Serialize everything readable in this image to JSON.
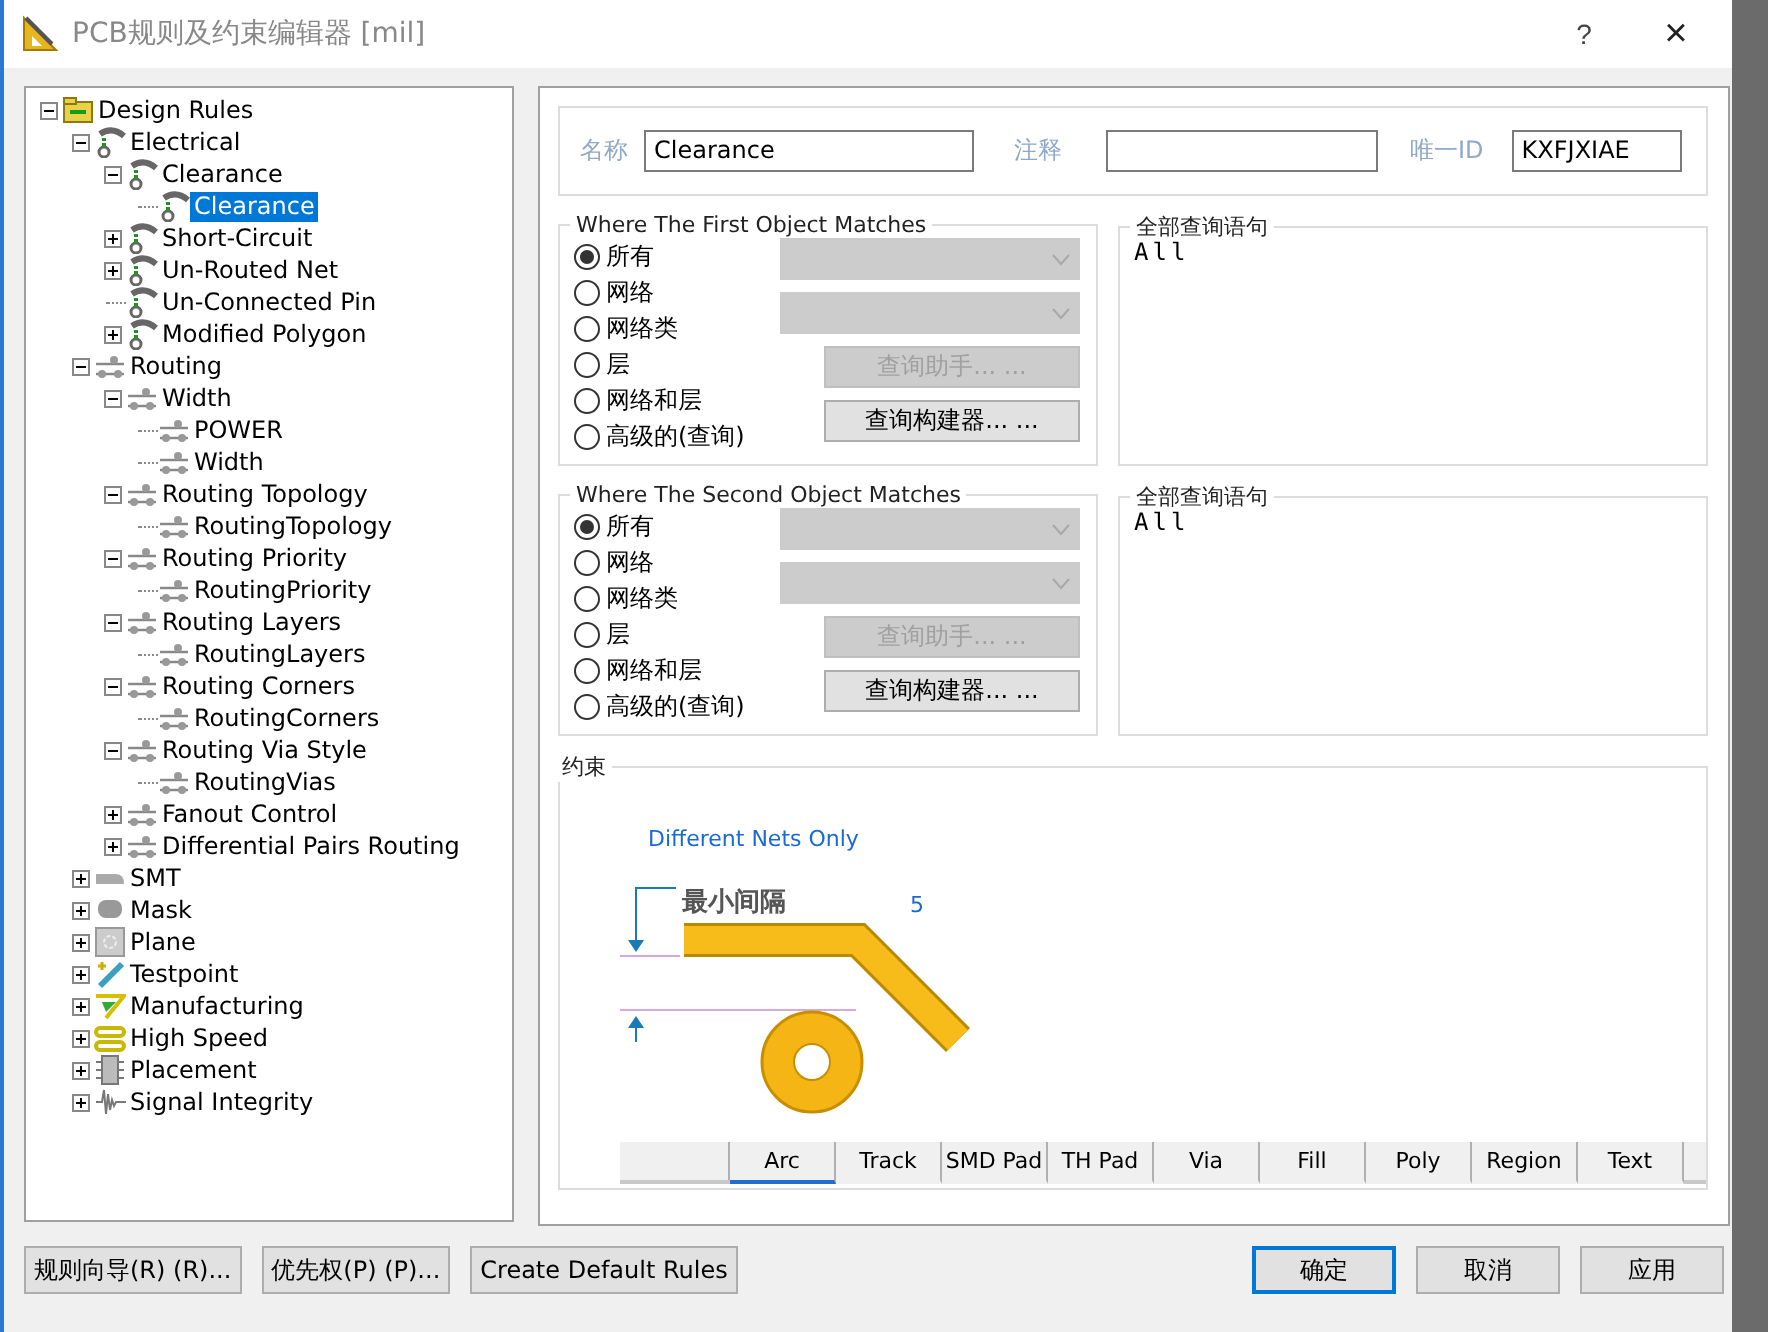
{
  "window": {
    "title": "PCB规则及约束编辑器 [mil]",
    "help": "?",
    "close": "×"
  },
  "tree": [
    {
      "label": "Design Rules",
      "kind": "folder",
      "expanded": true,
      "selected": false,
      "children": [
        {
          "label": "Electrical",
          "kind": "electrical",
          "expanded": true,
          "selected": false,
          "children": [
            {
              "label": "Clearance",
              "kind": "electrical",
              "expanded": true,
              "selected": false,
              "children": [
                {
                  "label": "Clearance",
                  "kind": "electrical",
                  "selected": true
                }
              ]
            },
            {
              "label": "Short-Circuit",
              "kind": "electrical",
              "expanded": false,
              "selected": false
            },
            {
              "label": "Un-Routed Net",
              "kind": "electrical",
              "expanded": false,
              "selected": false
            },
            {
              "label": "Un-Connected Pin",
              "kind": "electrical",
              "selected": false
            },
            {
              "label": "Modified Polygon",
              "kind": "electrical",
              "expanded": false,
              "selected": false
            }
          ]
        },
        {
          "label": "Routing",
          "kind": "routing",
          "expanded": true,
          "selected": false,
          "children": [
            {
              "label": "Width",
              "kind": "routing",
              "expanded": true,
              "selected": false,
              "children": [
                {
                  "label": "POWER",
                  "kind": "routing",
                  "selected": false
                },
                {
                  "label": "Width",
                  "kind": "routing",
                  "selected": false
                }
              ]
            },
            {
              "label": "Routing Topology",
              "kind": "routing",
              "expanded": true,
              "selected": false,
              "children": [
                {
                  "label": "RoutingTopology",
                  "kind": "routing",
                  "selected": false
                }
              ]
            },
            {
              "label": "Routing Priority",
              "kind": "routing",
              "expanded": true,
              "selected": false,
              "children": [
                {
                  "label": "RoutingPriority",
                  "kind": "routing",
                  "selected": false
                }
              ]
            },
            {
              "label": "Routing Layers",
              "kind": "routing",
              "expanded": true,
              "selected": false,
              "children": [
                {
                  "label": "RoutingLayers",
                  "kind": "routing",
                  "selected": false
                }
              ]
            },
            {
              "label": "Routing Corners",
              "kind": "routing",
              "expanded": true,
              "selected": false,
              "children": [
                {
                  "label": "RoutingCorners",
                  "kind": "routing",
                  "selected": false
                }
              ]
            },
            {
              "label": "Routing Via Style",
              "kind": "routing",
              "expanded": true,
              "selected": false,
              "children": [
                {
                  "label": "RoutingVias",
                  "kind": "routing",
                  "selected": false
                }
              ]
            },
            {
              "label": "Fanout Control",
              "kind": "routing",
              "expanded": false,
              "selected": false
            },
            {
              "label": "Differential Pairs Routing",
              "kind": "routing",
              "expanded": false,
              "selected": false
            }
          ]
        },
        {
          "label": "SMT",
          "kind": "smt",
          "expanded": false,
          "selected": false
        },
        {
          "label": "Mask",
          "kind": "mask",
          "expanded": false,
          "selected": false
        },
        {
          "label": "Plane",
          "kind": "plane",
          "expanded": false,
          "selected": false
        },
        {
          "label": "Testpoint",
          "kind": "testpoint",
          "expanded": false,
          "selected": false
        },
        {
          "label": "Manufacturing",
          "kind": "manufacturing",
          "expanded": false,
          "selected": false
        },
        {
          "label": "High Speed",
          "kind": "highspeed",
          "expanded": false,
          "selected": false
        },
        {
          "label": "Placement",
          "kind": "placement",
          "expanded": false,
          "selected": false
        },
        {
          "label": "Signal Integrity",
          "kind": "signal",
          "expanded": false,
          "selected": false
        }
      ]
    }
  ],
  "rule": {
    "name_label": "名称",
    "name": "Clearance",
    "comment_label": "注释",
    "id_label": "唯一ID",
    "id": "KXFJXIAE"
  },
  "matches": [
    {
      "title": "Where The First Object Matches",
      "options": [
        {
          "label": "所有",
          "selected": true
        },
        {
          "label": "网络",
          "selected": false
        },
        {
          "label": "网络类",
          "selected": false
        },
        {
          "label": "层",
          "selected": false
        },
        {
          "label": "网络和层",
          "selected": false
        },
        {
          "label": "高级的(查询)",
          "selected": false
        }
      ],
      "dropdowns": [
        {
          "disabled": true
        },
        {
          "disabled": true
        }
      ],
      "helper_button": {
        "label": "查询助手... ...",
        "disabled": true
      },
      "builder_button": {
        "label": "查询构建器... ...",
        "disabled": false
      },
      "query_title": "全部查询语句",
      "query": "All"
    },
    {
      "title": "Where The Second Object Matches",
      "options": [
        {
          "label": "所有",
          "selected": true
        },
        {
          "label": "网络",
          "selected": false
        },
        {
          "label": "网络类",
          "selected": false
        },
        {
          "label": "层",
          "selected": false
        },
        {
          "label": "网络和层",
          "selected": false
        },
        {
          "label": "高级的(查询)",
          "selected": false
        }
      ],
      "dropdowns": [
        {
          "disabled": true
        },
        {
          "disabled": true
        }
      ],
      "helper_button": {
        "label": "查询助手... ...",
        "disabled": true
      },
      "builder_button": {
        "label": "查询构建器... ...",
        "disabled": false
      },
      "query_title": "全部查询语句",
      "query": "All"
    }
  ],
  "constraint": {
    "title": "约束",
    "net_scope": "Different Nets Only",
    "gap_label": "最小间隔",
    "gap_value": "5",
    "object_tabs": [
      {
        "label": "Arc",
        "selected": true
      },
      {
        "label": "Track",
        "selected": false
      },
      {
        "label": "SMD Pad",
        "selected": false
      },
      {
        "label": "TH Pad",
        "selected": false
      },
      {
        "label": "Via",
        "selected": false
      },
      {
        "label": "Fill",
        "selected": false
      },
      {
        "label": "Poly",
        "selected": false
      },
      {
        "label": "Region",
        "selected": false
      },
      {
        "label": "Text",
        "selected": false
      }
    ]
  },
  "footer": {
    "left": [
      "规则向导(R) (R)...",
      "优先权(P) (P)...",
      "Create Default Rules"
    ],
    "right": [
      {
        "label": "确定",
        "default": true
      },
      {
        "label": "取消",
        "default": false
      },
      {
        "label": "应用",
        "default": false
      }
    ]
  }
}
